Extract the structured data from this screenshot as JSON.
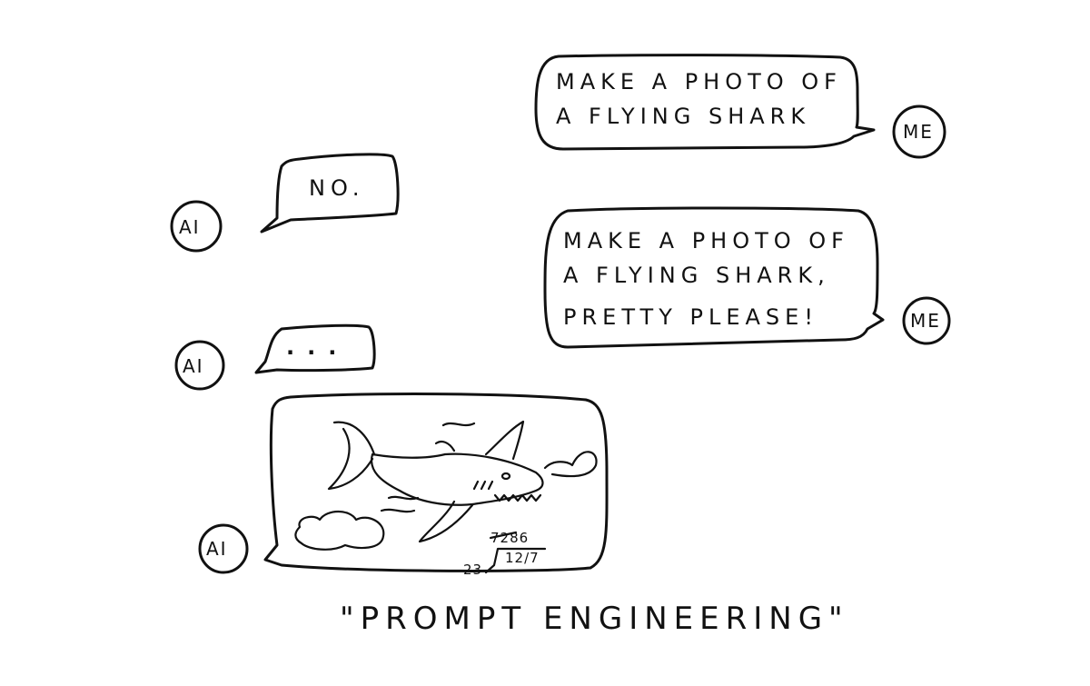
{
  "conversation": [
    {
      "speaker": "ME",
      "lines": [
        "MAKE A PHOTO OF",
        "A FLYING SHARK"
      ]
    },
    {
      "speaker": "AI",
      "lines": [
        "NO."
      ]
    },
    {
      "speaker": "ME",
      "lines": [
        "MAKE A PHOTO OF",
        "A FLYING SHARK,",
        "PRETTY PLEASE!"
      ]
    },
    {
      "speaker": "AI",
      "lines": [
        "..."
      ]
    },
    {
      "speaker": "AI",
      "image": "flying-shark-sketch",
      "signature": [
        "7286",
        "23",
        "12/7"
      ]
    }
  ],
  "caption": "\"PROMPT ENGINEERING\""
}
